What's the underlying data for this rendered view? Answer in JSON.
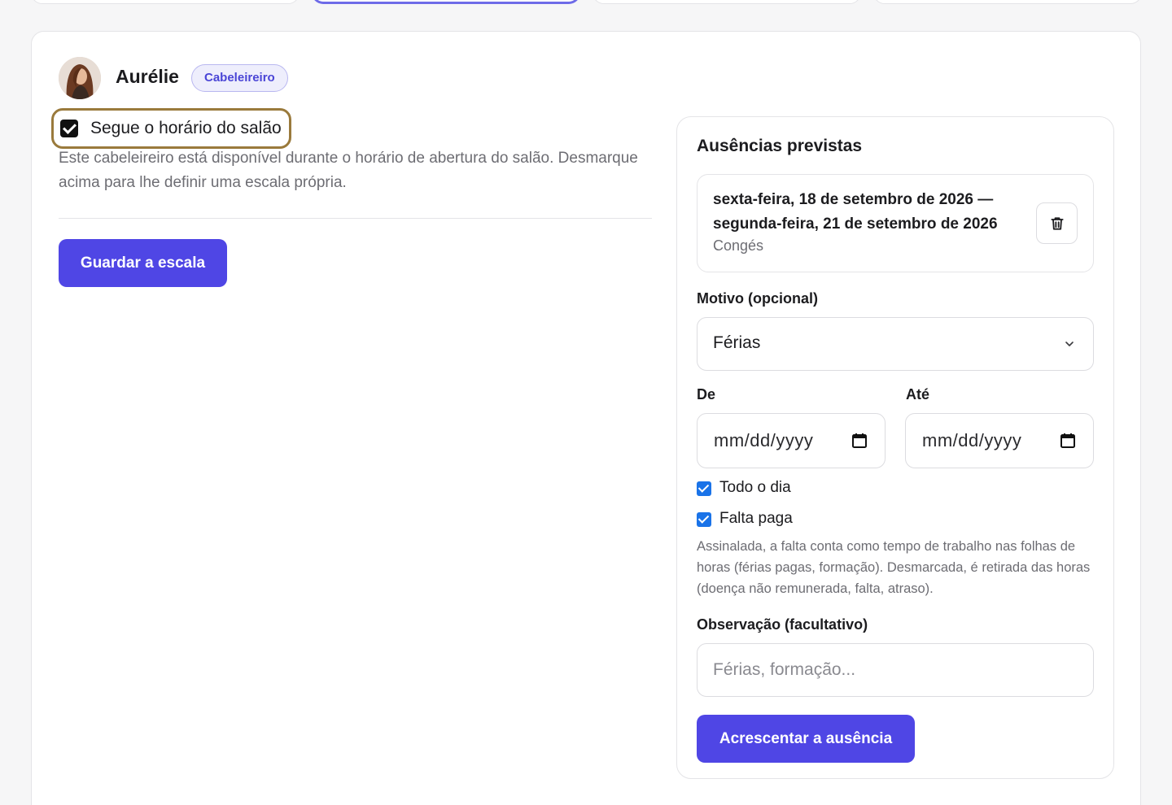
{
  "staff": {
    "name": "Aurélie",
    "role": "Cabeleireiro"
  },
  "schedule": {
    "follow_salon_label": "Segue o horário do salão",
    "follow_salon_checked": true,
    "description": "Este cabeleireiro está disponível durante o horário de abertura do salão. Desmarque acima para lhe definir uma escala própria.",
    "save_label": "Guardar a escala"
  },
  "absences": {
    "title": "Ausências previstas",
    "items": [
      {
        "range": "sexta-feira, 18 de setembro de 2026 — segunda-feira, 21 de setembro de 2026",
        "reason": "Congés"
      }
    ]
  },
  "form": {
    "reason_label": "Motivo (opcional)",
    "reason_value": "Férias",
    "from_label": "De",
    "to_label": "Até",
    "date_placeholder": "mm/dd/yyyy",
    "all_day_label": "Todo o dia",
    "all_day_checked": true,
    "paid_label": "Falta paga",
    "paid_checked": true,
    "paid_hint": "Assinalada, a falta conta como tempo de trabalho nas folhas de horas (férias pagas, formação). Desmarcada, é retirada das horas (doença não remunerada, falta, atraso).",
    "note_label": "Observação (facultativo)",
    "note_placeholder": "Férias, formação...",
    "add_label": "Acrescentar a ausência"
  },
  "colors": {
    "primary": "#4f46e5",
    "focus_ring": "#9a7a3c",
    "checkbox_blue": "#1a73e8"
  }
}
